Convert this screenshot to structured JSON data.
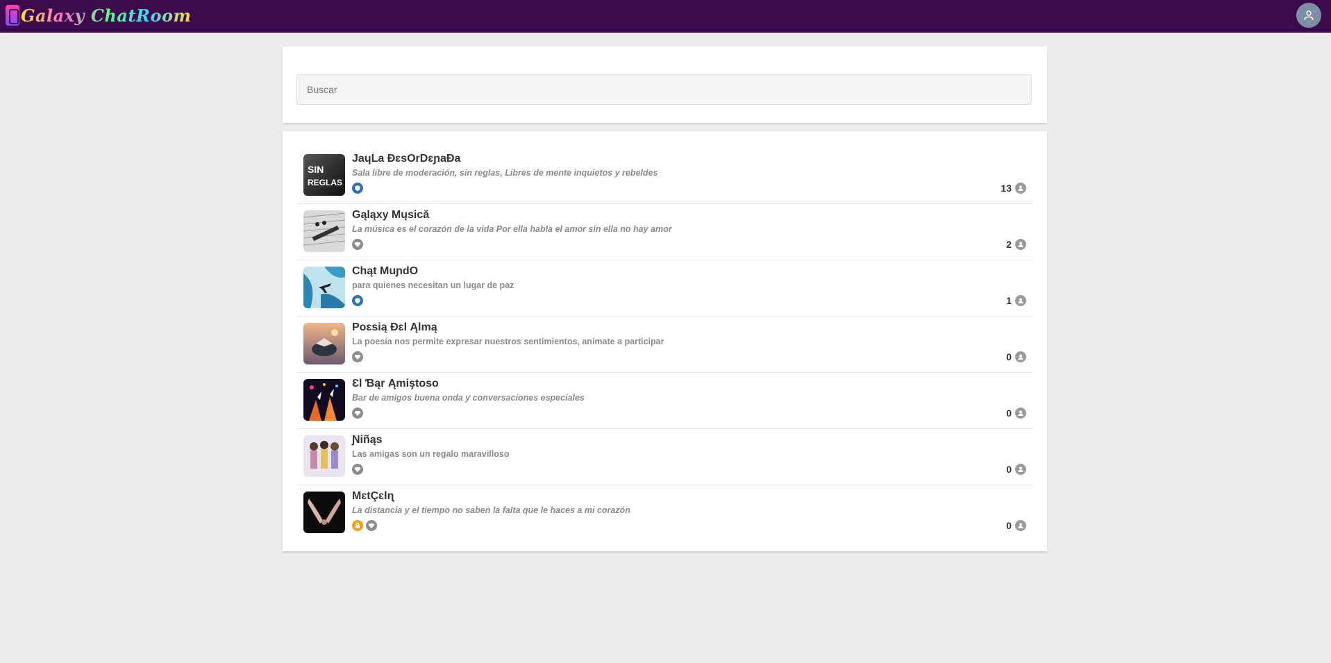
{
  "app": {
    "logo_text": "Galaxy ChatRoom"
  },
  "colors": {
    "topbar": "#3d0a4b",
    "accent_blue": "#2f6fb6",
    "badge_gray": "#8c8c8c",
    "lock_orange": "#f0a019"
  },
  "search": {
    "placeholder": "Buscar",
    "value": ""
  },
  "rooms": [
    {
      "name": "JaɥLa ĐɛsOrDɛɲaĐa",
      "description": "Sala libre de moderación, sin reglas, Libres de mente inquietos y rebeldes",
      "badges": [
        "blue-shield-icon"
      ],
      "users": "13"
    },
    {
      "name": "Gąląxy Mųsică",
      "description": "La música es el corazón de la vida Por ella habla el amor sin ella no hay amor",
      "badges": [
        "gray-gem-icon"
      ],
      "users": "2"
    },
    {
      "name": "Chąt MuɲdO",
      "description": "para quienes necesitan un lugar de paz",
      "badges": [
        "blue-shield-icon"
      ],
      "users": "1"
    },
    {
      "name": "Poɛsią Đɛl Ąlmą",
      "description": "La poesía nos permite expresar nuestros sentimientos, anímate a participar",
      "badges": [
        "gray-gem-icon"
      ],
      "users": "0"
    },
    {
      "name": "Ɛl Ɓąr Ąmiştoso",
      "description": "Bar de amigos buena onda y conversaciones especiales",
      "badges": [
        "gray-gem-icon"
      ],
      "users": "0"
    },
    {
      "name": "Ɲiñąs",
      "description": "Las amigas son un regalo maravilloso",
      "badges": [
        "gray-gem-icon"
      ],
      "users": "0"
    },
    {
      "name": "MɛtÇɛlɳ",
      "description": "La distancia y el tiempo no saben la falta que le haces a mi corazón",
      "badges": [
        "orange-lock-icon",
        "gray-gem-icon"
      ],
      "users": "0"
    }
  ]
}
